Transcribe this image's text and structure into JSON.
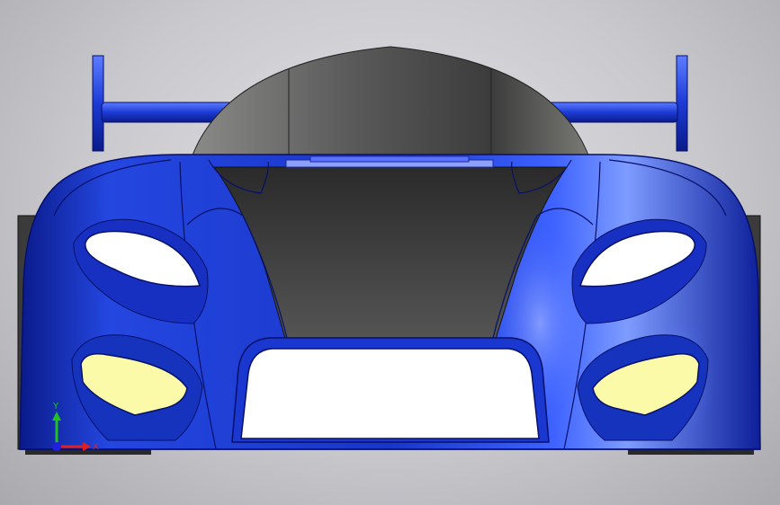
{
  "scene": {
    "subject": "race-car-front-view",
    "colors": {
      "body_blue": "#1f3fd6",
      "body_blue_dark": "#0b1f9c",
      "body_highlight": "#7fa0ff",
      "canopy_gray": "#4a4a4a",
      "headlight_white": "#ffffff",
      "fog_light_yellow": "#fbfaa8",
      "grille_white": "#ffffff",
      "background": "#d0d0d4"
    }
  },
  "triad": {
    "x_label": "X",
    "y_label": "Y",
    "x_color": "#e02020",
    "y_color": "#20c020",
    "z_color": "#2020e0"
  }
}
